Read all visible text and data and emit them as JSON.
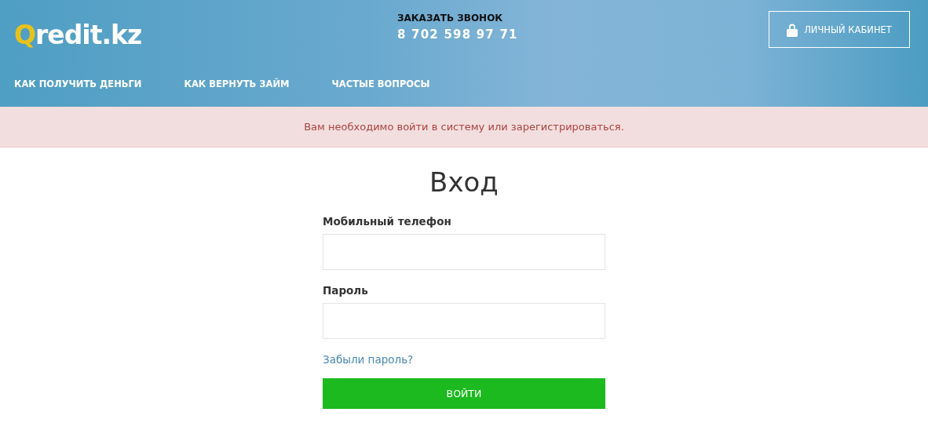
{
  "header": {
    "logo": {
      "mark": "Q",
      "rest": "redit.kz"
    },
    "callback": {
      "label": "ЗАКАЗАТЬ ЗВОНОК",
      "phone": "8 702 598 97 71"
    },
    "account_button": "ЛИЧНЫЙ КАБИНЕТ"
  },
  "nav": [
    {
      "label": "КАК ПОЛУЧИТЬ ДЕНЬГИ"
    },
    {
      "label": "КАК ВЕРНУТЬ ЗАЙМ"
    },
    {
      "label": "ЧАСТЫЕ ВОПРОСЫ"
    }
  ],
  "alert": "Вам необходимо войти в систему или зарегистрироваться.",
  "form": {
    "title": "Вход",
    "fields": [
      {
        "label": "Мобильный телефон"
      },
      {
        "label": "Пароль"
      }
    ],
    "forgot_link": "Забыли пароль?",
    "submit": "ВОЙТИ"
  }
}
